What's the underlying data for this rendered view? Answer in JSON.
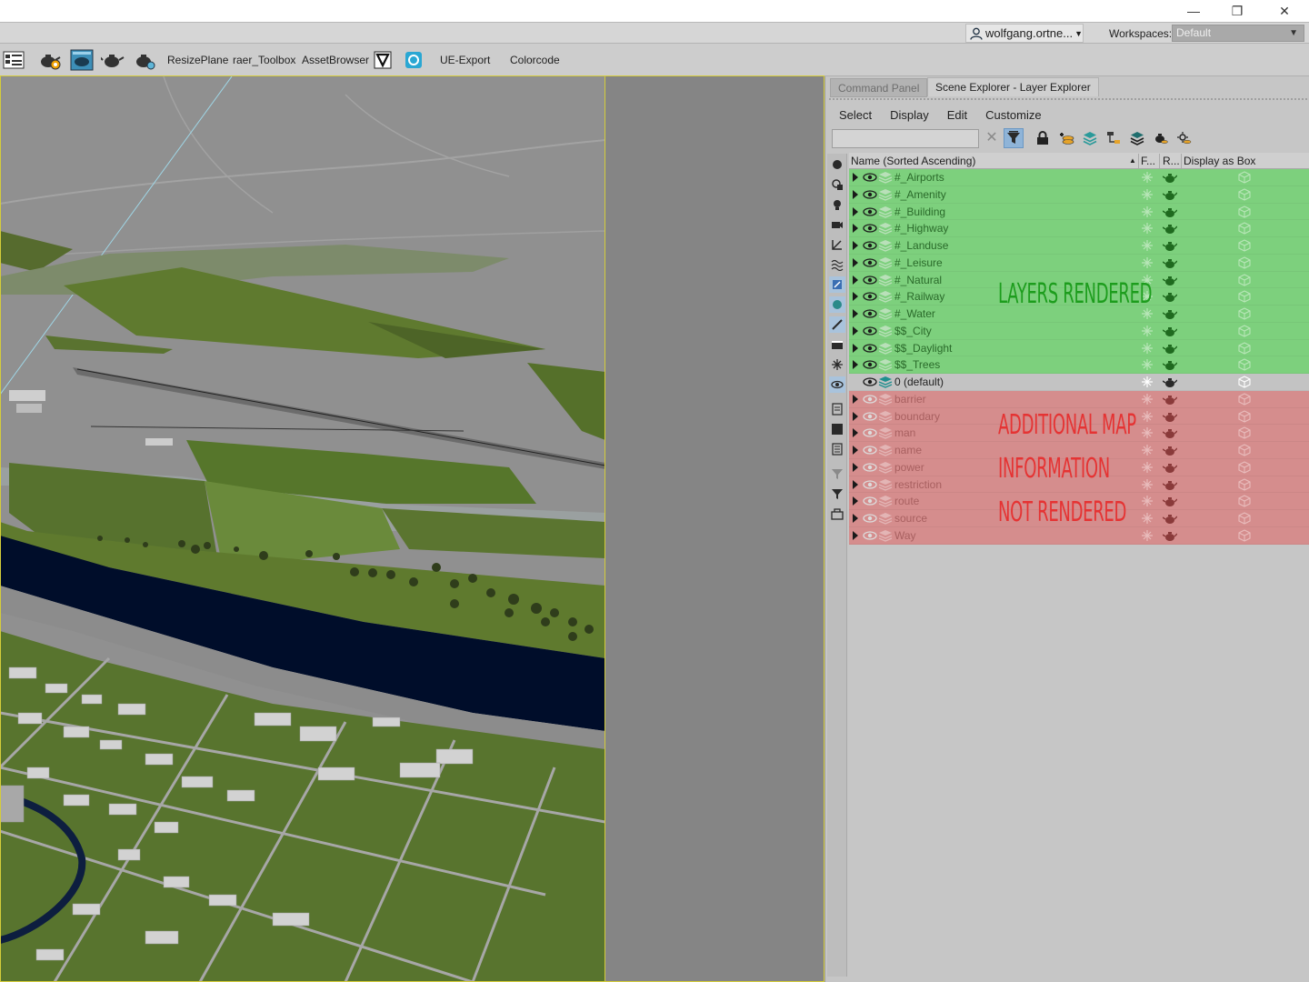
{
  "titlebar": {
    "minimize_glyph": "—",
    "restore_glyph": "❐",
    "close_glyph": "✕"
  },
  "userbar": {
    "user_name": "wolfgang.ortne...",
    "workspaces_label": "Workspaces:",
    "workspace_value": "Default"
  },
  "toolbar": {
    "items": [
      {
        "label": "ResizePlane"
      },
      {
        "label": "raer_Toolbox"
      },
      {
        "label": "AssetBrowser"
      },
      {
        "label": "UE-Export"
      },
      {
        "label": "Colorcode"
      }
    ],
    "icons": [
      "layout-icon",
      "teapot-settings-icon",
      "teapot-render-icon",
      "teapot-frame-icon",
      "teapot-light-icon",
      "v-logo-icon",
      "circle-logo-icon"
    ]
  },
  "panel": {
    "tabs": [
      {
        "label": "Command Panel",
        "active": false
      },
      {
        "label": "Scene Explorer - Layer Explorer",
        "active": true
      }
    ],
    "menu": [
      "Select",
      "Display",
      "Edit",
      "Customize"
    ],
    "search": {
      "value": "",
      "clear_glyph": "✕"
    },
    "columns": {
      "name": "Name (Sorted Ascending)",
      "sort_glyph": "▲",
      "frozen": "F...",
      "render": "R...",
      "display_as_box": "Display as Box"
    },
    "layers": [
      {
        "name": "#_Airports",
        "state": "green"
      },
      {
        "name": "#_Amenity",
        "state": "green"
      },
      {
        "name": "#_Building",
        "state": "green"
      },
      {
        "name": "#_Highway",
        "state": "green"
      },
      {
        "name": "#_Landuse",
        "state": "green"
      },
      {
        "name": "#_Leisure",
        "state": "green"
      },
      {
        "name": "#_Natural",
        "state": "green"
      },
      {
        "name": "#_Railway",
        "state": "green"
      },
      {
        "name": "#_Water",
        "state": "green"
      },
      {
        "name": "$$_City",
        "state": "green"
      },
      {
        "name": "$$_Daylight",
        "state": "green"
      },
      {
        "name": "$$_Trees",
        "state": "green"
      },
      {
        "name": "0 (default)",
        "state": "gray"
      },
      {
        "name": "barrier",
        "state": "red"
      },
      {
        "name": "boundary",
        "state": "red"
      },
      {
        "name": "man",
        "state": "red"
      },
      {
        "name": "name",
        "state": "red"
      },
      {
        "name": "power",
        "state": "red"
      },
      {
        "name": "restriction",
        "state": "red"
      },
      {
        "name": "route",
        "state": "red"
      },
      {
        "name": "source",
        "state": "red"
      },
      {
        "name": "Way",
        "state": "red"
      }
    ],
    "annotations": {
      "rendered": "LAYERS RENDERED",
      "not_rendered_1": "ADDITIONAL MAP",
      "not_rendered_2": "INFORMATION",
      "not_rendered_3": "NOT RENDERED"
    }
  },
  "colors": {
    "rendered_row": "#7dd07d",
    "not_rendered_row": "#d58d8d",
    "default_row": "#c3c3c3",
    "viewport_border": "#d4cc3a",
    "annotation_green": "#1d9d1d",
    "annotation_red": "#e53333"
  }
}
